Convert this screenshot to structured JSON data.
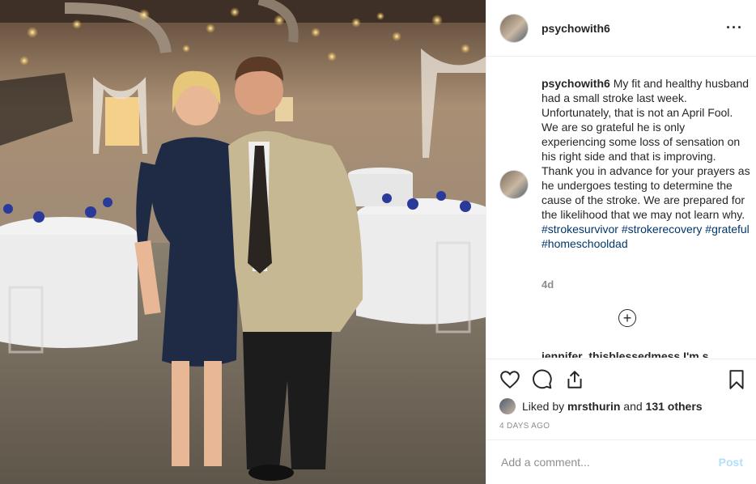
{
  "post": {
    "username": "psychowith6",
    "more_icon": "ellipsis-icon"
  },
  "caption": {
    "username": "psychowith6",
    "text": "My fit and healthy husband had a small stroke last week. Unfortunately, that is not an April Fool. We are so grateful he is only experiencing some loss of sensation on his right side and that is improving. Thank you in advance for your prayers as he undergoes testing to determine the cause of the stroke. We are prepared for the likelihood that we may not learn why. ",
    "hashtags": [
      "#strokesurvivor",
      "#strokerecovery",
      "#grateful",
      "#homeschooldad"
    ],
    "age": "4d"
  },
  "next_comment_preview": "jennifer_thisblessedmess I'm s",
  "actions": [
    "heart-icon",
    "comment-icon",
    "share-icon",
    "bookmark-icon"
  ],
  "likes": {
    "prefix": "Liked by ",
    "user": "mrsthurin",
    "middle": " and ",
    "others": "131 others"
  },
  "timestamp": "4 DAYS AGO",
  "comment_input": {
    "placeholder": "Add a comment..."
  },
  "post_button": "Post",
  "colors": {
    "link": "#00376b",
    "post_disabled": "#b2dffc",
    "muted": "#8e8e8e"
  }
}
